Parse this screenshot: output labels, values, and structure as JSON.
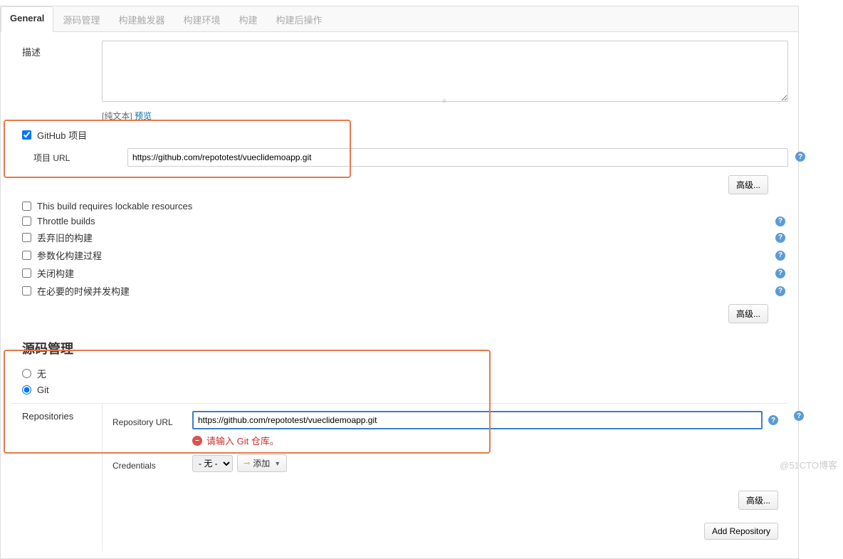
{
  "tabs": {
    "general": "General",
    "scm": "源码管理",
    "triggers": "构建触发器",
    "env": "构建环境",
    "build": "构建",
    "post": "构建后操作"
  },
  "general": {
    "desc_label": "描述",
    "plaintext_prefix": "[纯文本]",
    "preview": "预览",
    "github_project": "GitHub 项目",
    "project_url_label": "项目 URL",
    "project_url": "https://github.com/repototest/vueclidemoapp.git",
    "lockable": "This build requires lockable resources",
    "throttle": "Throttle builds",
    "discard": "丢弃旧的构建",
    "parametrize": "参数化构建过程",
    "disable": "关闭构建",
    "concurrent": "在必要的时候并发构建",
    "advanced": "高级..."
  },
  "scm": {
    "title": "源码管理",
    "none": "无",
    "git": "Git",
    "repositories": "Repositories",
    "repo_url_label": "Repository URL",
    "repo_url": "https://github.com/repototest/vueclidemoapp.git",
    "error": "请输入 Git 仓库。",
    "cred_label": "Credentials",
    "cred_none": "- 无 -",
    "add": "添加",
    "advanced": "高级...",
    "add_repo": "Add Repository"
  },
  "watermark": "@51CTO博客"
}
